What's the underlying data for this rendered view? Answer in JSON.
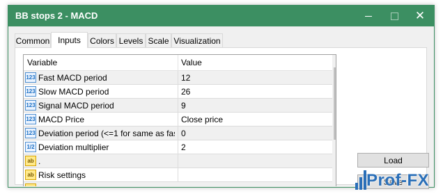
{
  "window": {
    "title": "BB stops 2 - MACD",
    "minimize_icon": "minimize-icon",
    "maximize_icon": "maximize-icon",
    "close_icon": "close-icon",
    "close_glyph": "✕",
    "accent_color": "#3c8f62"
  },
  "tabs": [
    {
      "label": "Common",
      "active": false
    },
    {
      "label": "Inputs",
      "active": true
    },
    {
      "label": "Colors",
      "active": false
    },
    {
      "label": "Levels",
      "active": false
    },
    {
      "label": "Scale",
      "active": false
    },
    {
      "label": "Visualization",
      "active": false
    }
  ],
  "grid": {
    "columns": [
      "Variable",
      "Value"
    ],
    "rows": [
      {
        "icon": "int-icon",
        "icon_text": "123",
        "variable": "Fast MACD period",
        "value": "12"
      },
      {
        "icon": "int-icon",
        "icon_text": "123",
        "variable": "Slow MACD period",
        "value": "26"
      },
      {
        "icon": "int-icon",
        "icon_text": "123",
        "variable": "Signal MACD period",
        "value": "9"
      },
      {
        "icon": "enum-icon",
        "icon_text": "123",
        "variable": "MACD Price",
        "value": "Close price"
      },
      {
        "icon": "int-icon",
        "icon_text": "123",
        "variable": "Deviation period (<=1 for same as fas...",
        "value": "0"
      },
      {
        "icon": "double-icon",
        "icon_text": "1/2",
        "variable": "Deviation multiplier",
        "value": "2"
      },
      {
        "icon": "string-icon",
        "icon_text": "ab",
        "variable": ".",
        "value": ""
      },
      {
        "icon": "string-icon",
        "icon_text": "ab",
        "variable": "Risk settings",
        "value": ""
      }
    ],
    "scroll_up_glyph": "▲",
    "scroll_down_glyph": "▼"
  },
  "buttons": {
    "load": "Load",
    "save": "Save"
  },
  "watermark": {
    "text": "Prof-FX",
    "color": "#2a6fb8"
  }
}
